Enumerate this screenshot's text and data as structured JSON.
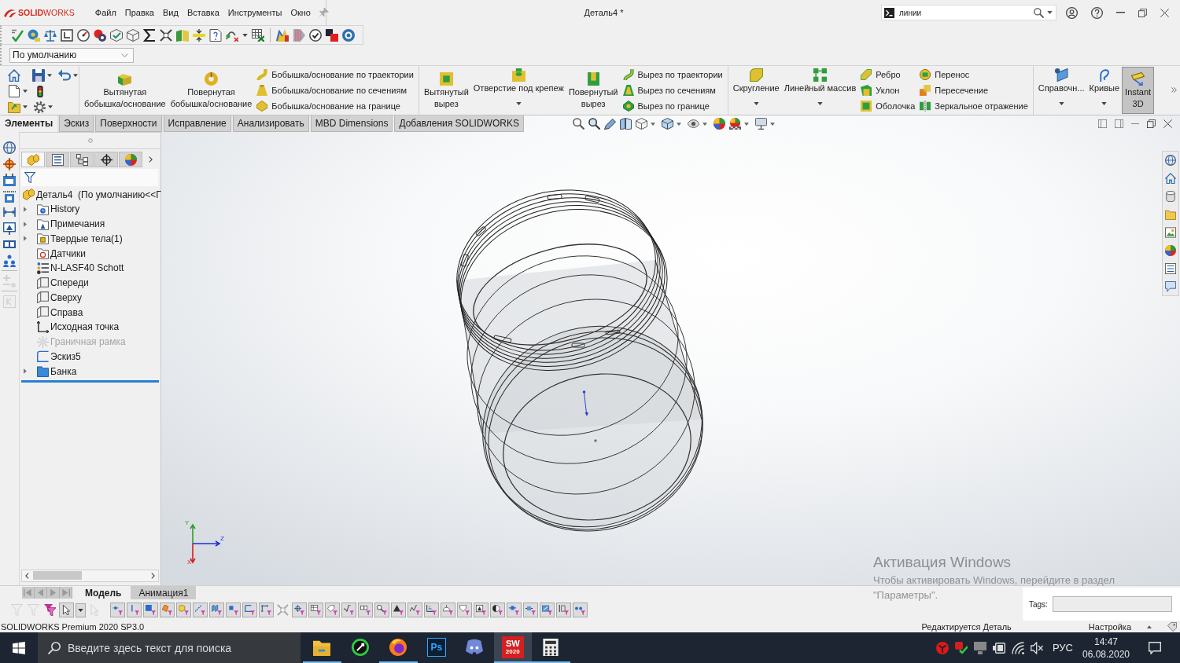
{
  "title_bar": {
    "brand": "**SOLID**WORKS",
    "menu": [
      "Файл",
      "Правка",
      "Вид",
      "Вставка",
      "Инструменты",
      "Окно"
    ],
    "document": "Деталь4 *",
    "search": {
      "value": "линии"
    }
  },
  "configuration": {
    "value": "По умолчанию"
  },
  "ribbon": {
    "groups": [
      [
        {
          "kind": "large",
          "lines": [
            "Вытянутая",
            "бобышка/основание"
          ]
        },
        {
          "kind": "large",
          "lines": [
            "Повернутая",
            "бобышка/основание"
          ]
        },
        {
          "kind": "stack",
          "items": [
            "Бобышка/основание по траектории",
            "Бобышка/основание по сечениям",
            "Бобышка/основание на границе"
          ]
        }
      ],
      [
        {
          "kind": "large",
          "lines": [
            "Вытянутый",
            "вырез"
          ]
        },
        {
          "kind": "dropdown",
          "label": "Отверстие под крепеж"
        },
        {
          "kind": "large",
          "lines": [
            "Повернутый",
            "вырез"
          ]
        },
        {
          "kind": "stack",
          "items": [
            "Вырез по траектории",
            "Вырез по сечениям",
            "Вырез по границе"
          ]
        }
      ],
      [
        {
          "kind": "dropdown",
          "label": "Скругление"
        },
        {
          "kind": "dropdown",
          "label": "Линейный массив"
        },
        {
          "kind": "stack",
          "items": [
            "Ребро",
            "Уклон",
            "Оболочка"
          ]
        },
        {
          "kind": "stack",
          "items": [
            "Перенос",
            "Пересечение",
            "Зеркальное отражение"
          ]
        }
      ],
      [
        {
          "kind": "dropdown",
          "label": "Справочн..."
        },
        {
          "kind": "dropdown",
          "label": "Кривые"
        },
        {
          "kind": "toggle",
          "lines": [
            "Instant",
            "3D"
          ],
          "selected": true
        }
      ]
    ]
  },
  "command_tabs": [
    {
      "label": "Элементы",
      "selected": true
    },
    {
      "label": "Эскиз",
      "selected": false
    },
    {
      "label": "Поверхности",
      "selected": false
    },
    {
      "label": "Исправление",
      "selected": false
    },
    {
      "label": "Анализировать",
      "selected": false
    },
    {
      "label": "MBD Dimensions",
      "selected": false
    },
    {
      "label": "Добавления SOLIDWORKS",
      "selected": false
    }
  ],
  "feature_manager": {
    "tabs": [
      {
        "selected": true
      },
      {
        "selected": false
      },
      {
        "selected": false
      },
      {
        "selected": false
      },
      {
        "selected": false
      }
    ],
    "root": "Деталь4  (По умолчанию<<Г",
    "items": [
      {
        "label": "History",
        "kind": "history",
        "expandable": true,
        "disabled": false
      },
      {
        "label": "Примечания",
        "kind": "annotations",
        "expandable": true,
        "disabled": false
      },
      {
        "label": "Твердые тела(1)",
        "kind": "bodies",
        "expandable": true,
        "disabled": false
      },
      {
        "label": "Датчики",
        "kind": "sensors",
        "expandable": false,
        "disabled": false
      },
      {
        "label": "N-LASF40 Schott",
        "kind": "material",
        "expandable": false,
        "disabled": false
      },
      {
        "label": "Спереди",
        "kind": "plane",
        "expandable": false,
        "disabled": false
      },
      {
        "label": "Сверху",
        "kind": "plane",
        "expandable": false,
        "disabled": false
      },
      {
        "label": "Справа",
        "kind": "plane",
        "expandable": false,
        "disabled": false
      },
      {
        "label": "Исходная точка",
        "kind": "origin",
        "expandable": false,
        "disabled": false
      },
      {
        "label": "Граничная рамка",
        "kind": "bounding_box",
        "expandable": false,
        "disabled": true
      },
      {
        "label": "Эскиз5",
        "kind": "sketch",
        "expandable": false,
        "disabled": false
      },
      {
        "label": "Банка",
        "kind": "folder",
        "expandable": true,
        "disabled": false
      }
    ]
  },
  "viewport": {
    "triad_labels": [
      "Y",
      "Z",
      "X"
    ]
  },
  "model_tabs": [
    {
      "label": "Модель",
      "selected": true
    },
    {
      "label": "Анимация1",
      "selected": false
    }
  ],
  "tags": {
    "label": "Tags:"
  },
  "status_bar": {
    "product": "SOLIDWORKS Premium 2020 SP3.0",
    "mode": "Редактируется Деталь",
    "units": "Настройка"
  },
  "activation_notice": {
    "title": "Активация Windows",
    "lines": [
      "Чтобы активировать Windows, перейдите в раздел",
      "\"Параметры\"."
    ]
  },
  "taskbar": {
    "search_placeholder": "Введите здесь текст для поиска",
    "apps": [
      {
        "selected": false,
        "running": true
      },
      {
        "selected": false,
        "running": false
      },
      {
        "selected": false,
        "running": true
      },
      {
        "selected": false,
        "running": false,
        "text": "Ps"
      },
      {
        "selected": false,
        "running": false
      },
      {
        "selected": true,
        "running": true,
        "text": "SW",
        "subtext": "2020"
      },
      {
        "selected": false,
        "running": true
      }
    ],
    "language": "РУС",
    "time": "14:47",
    "date": "06.08.2020"
  }
}
